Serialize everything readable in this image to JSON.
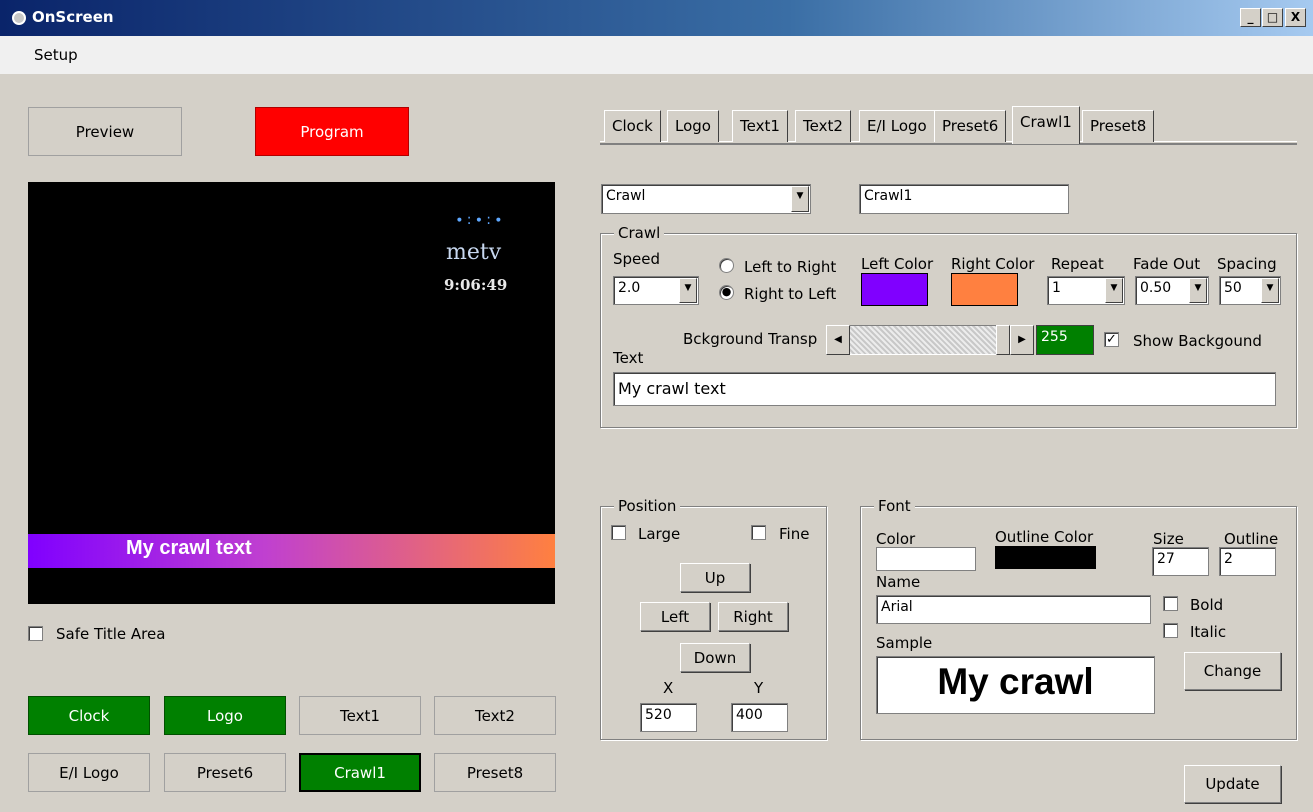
{
  "window": {
    "title": "OnScreen",
    "minimize": "_",
    "maximize": "□",
    "close": "X"
  },
  "menu": {
    "setup": "Setup"
  },
  "preview_button": "Preview",
  "program_button": "Program",
  "screen": {
    "logo_dots": "∙:∙:∙",
    "logo_text": "metv",
    "clock": "9:06:49",
    "crawl_text": "My crawl text"
  },
  "safe_title": {
    "label": "Safe Title Area",
    "checked": false
  },
  "bottom_buttons": {
    "clock": "Clock",
    "logo": "Logo",
    "text1": "Text1",
    "text2": "Text2",
    "ei_logo": "E/I Logo",
    "preset6": "Preset6",
    "crawl1": "Crawl1",
    "preset8": "Preset8"
  },
  "tabs": [
    "Clock",
    "Logo",
    "Text1",
    "Text2",
    "E/I Logo",
    "Preset6",
    "Crawl1",
    "Preset8"
  ],
  "active_tab": "Crawl1",
  "type_select": "Crawl",
  "name_field": "Crawl1",
  "crawl_group": {
    "title": "Crawl",
    "speed_label": "Speed",
    "speed_value": "2.0",
    "direction_ltr": "Left to Right",
    "direction_rtl": "Right to Left",
    "selected_direction": "Right to Left",
    "left_color_label": "Left Color",
    "left_color": "#8000ff",
    "right_color_label": "Right Color",
    "right_color": "#ff8040",
    "repeat_label": "Repeat",
    "repeat_value": "1",
    "fadeout_label": "Fade Out",
    "fadeout_value": "0.50",
    "spacing_label": "Spacing",
    "spacing_value": "50",
    "bg_transp_label": "Bckground Transp",
    "bg_transp_value": "255",
    "show_bg_label": "Show Backgound",
    "show_bg_checked": true,
    "text_label": "Text",
    "text_value": "My crawl text"
  },
  "position_group": {
    "title": "Position",
    "large_label": "Large",
    "fine_label": "Fine",
    "up": "Up",
    "left": "Left",
    "right": "Right",
    "down": "Down",
    "x_label": "X",
    "y_label": "Y",
    "x_value": "520",
    "y_value": "400"
  },
  "font_group": {
    "title": "Font",
    "color_label": "Color",
    "color_value": "#ffffff",
    "outline_color_label": "Outline Color",
    "outline_color_value": "#000000",
    "size_label": "Size",
    "size_value": "27",
    "outline_label": "Outline",
    "outline_value": "2",
    "name_label": "Name",
    "name_value": "Arial",
    "bold_label": "Bold",
    "italic_label": "Italic",
    "sample_label": "Sample",
    "sample_text": "My crawl",
    "change_button": "Change"
  },
  "update_button": "Update"
}
